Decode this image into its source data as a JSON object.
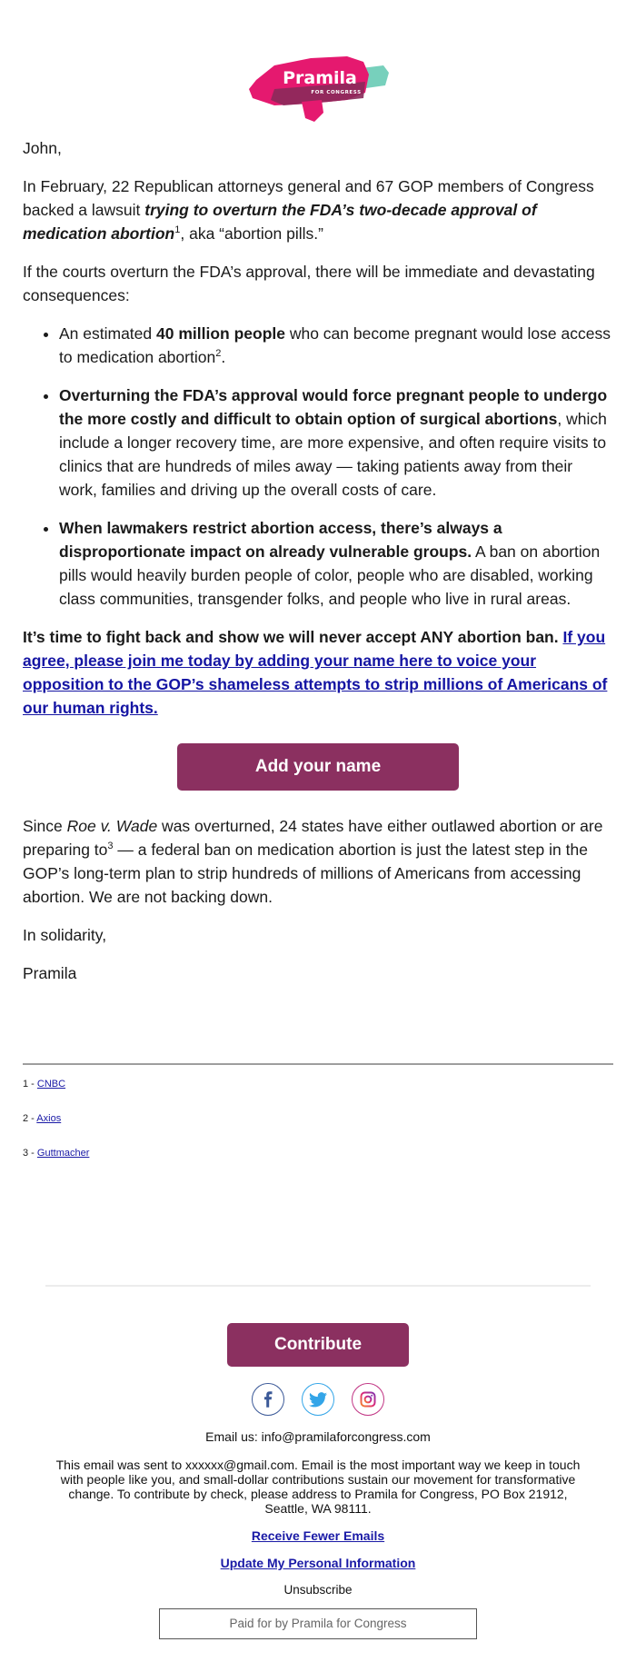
{
  "header": {
    "logo": {
      "name": "Pramila",
      "subtitle": "FOR CONGRESS",
      "colors": {
        "primary": "#e5196f",
        "secondary": "#8a2a5a",
        "accent": "#5fc8b0"
      }
    }
  },
  "body": {
    "greeting": "John,",
    "p1": {
      "text1": "In February, 22 Republican attorneys general and 67 GOP members of Congress backed a lawsuit ",
      "emphasis": "trying to overturn the FDA’s two-decade approval of medication abortion",
      "ref": "1",
      "text2": ", aka “abortion pills.”"
    },
    "p2": "If the courts overturn the FDA’s approval, there will be immediate and devastating consequences:",
    "bullets": [
      {
        "pre": "An estimated ",
        "bold": "40 million people",
        "post": " who can become pregnant would lose access to medication abortion",
        "ref": "2",
        "tail": "."
      },
      {
        "bold": "Overturning the FDA’s approval would force pregnant people to undergo the more costly and difficult to obtain option of surgical abortions",
        "post": ", which include a longer recovery time, are more expensive, and often require visits to clinics that are hundreds of miles away — taking patients away from their work, families and driving up the overall costs of care."
      },
      {
        "bold": "When lawmakers restrict abortion access, there’s always a disproportionate impact on already vulnerable groups.",
        "post": " A ban on abortion pills would heavily burden people of color, people who are disabled, working class communities, transgender folks, and people who live in rural areas."
      }
    ],
    "cta_paragraph": {
      "bold": "It’s time to fight back and show we will never accept ANY abortion ban. ",
      "link": "If you agree, please join me today by adding your name here to voice your opposition to the GOP’s shameless attempts to strip millions of Americans of our human rights."
    },
    "add_name_button": "Add your name",
    "p3": {
      "pre": "Since ",
      "italic": "Roe v. Wade",
      "mid": " was overturned, 24 states have either outlawed abortion or are preparing to",
      "ref": "3",
      "post": " — a federal ban on medication abortion is just the latest step in the GOP’s long-term plan to strip hundreds of millions of Americans from accessing abortion. We are not backing down."
    },
    "closing": "In solidarity,",
    "signature": "Pramila"
  },
  "footnotes": [
    {
      "num": "1 - ",
      "label": "CNBC"
    },
    {
      "num": "2 - ",
      "label": "Axios"
    },
    {
      "num": "3 - ",
      "label": "Guttmacher"
    }
  ],
  "footer": {
    "contribute_button": "Contribute",
    "social": [
      {
        "name": "facebook",
        "icon": "facebook-icon",
        "color": "#3b5998"
      },
      {
        "name": "twitter",
        "icon": "twitter-icon",
        "color": "#33a5e8"
      },
      {
        "name": "instagram",
        "icon": "instagram-icon",
        "color": "#c13584"
      }
    ],
    "email_us": "Email us: info@pramilaforcongress.com",
    "disclaimer": "This email was sent to xxxxxx@gmail.com. Email is the most important way we keep in touch with people like you, and small-dollar contributions sustain our movement for transformative change. To contribute by check, please address to Pramila for Congress, PO Box 21912, Seattle, WA 98111.",
    "links": {
      "fewer_emails": "Receive Fewer Emails",
      "update_info": "Update My Personal Information",
      "unsubscribe": "Unsubscribe"
    },
    "paid_for": "Paid for by Pramila for Congress"
  },
  "colors": {
    "button_bg": "#8b3060",
    "link": "#1515a3"
  }
}
